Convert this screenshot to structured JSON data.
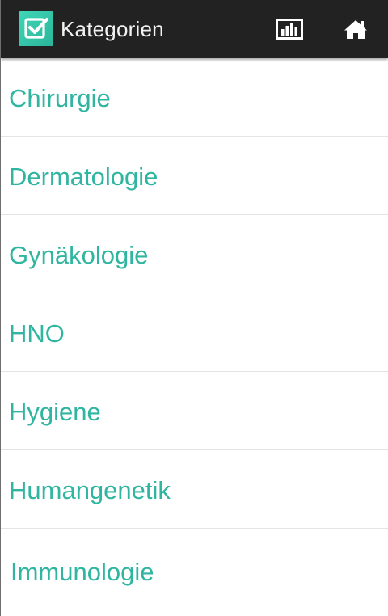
{
  "header": {
    "title": "Kategorien",
    "app_icon": "checkbox-icon",
    "actions": [
      {
        "name": "stats-icon"
      },
      {
        "name": "home-icon"
      }
    ]
  },
  "categories": [
    {
      "label": "Chirurgie"
    },
    {
      "label": "Dermatologie"
    },
    {
      "label": "Gynäkologie"
    },
    {
      "label": "HNO"
    },
    {
      "label": "Hygiene"
    },
    {
      "label": "Humangenetik"
    },
    {
      "label": "Immunologie"
    }
  ],
  "colors": {
    "actionbar": "#222222",
    "accent": "#2fb5a0",
    "divider": "#e4e4e4"
  }
}
